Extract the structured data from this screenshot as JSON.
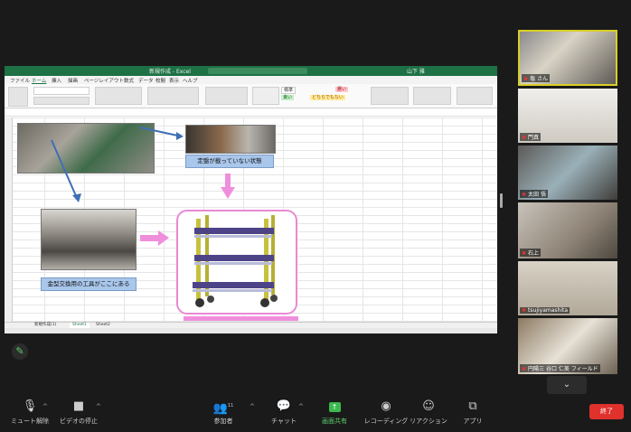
{
  "excel": {
    "title": "新規作成 - Excel",
    "user": "山下 雅",
    "ribbon_tabs": [
      "ファイル",
      "ホーム",
      "挿入",
      "描画",
      "ページレイアウト",
      "数式",
      "データ",
      "校閲",
      "表示",
      "ヘルプ"
    ],
    "styles": [
      "標準",
      "悪い",
      "良い",
      "どちらでもない"
    ],
    "label_top": "定盤が載っていない状態",
    "label_bottom": "金型交換用の工具がここにある",
    "sheet_tabs": [
      "新規作成(1)",
      "Sheet1",
      "Sheet2"
    ]
  },
  "participants": [
    {
      "name": "塩 さん"
    },
    {
      "name": "門真"
    },
    {
      "name": "太田 悟"
    },
    {
      "name": "石上"
    },
    {
      "name": "tsujiyamashita"
    },
    {
      "name": "円陽三 谷口 仁美 フィールド"
    }
  ],
  "toolbar": {
    "mute": "ミュート解除",
    "video": "ビデオの停止",
    "participants": "参加者",
    "participants_count": "11",
    "chat": "チャット",
    "share": "画面共有",
    "record": "レコーディング",
    "reactions": "リアクション",
    "apps": "アプリ",
    "end": "終了"
  },
  "colors": {
    "excel_green": "#1e7145",
    "end_red": "#e0312c",
    "active_speaker": "#d9ce27",
    "pink": "#ef8fdc"
  }
}
